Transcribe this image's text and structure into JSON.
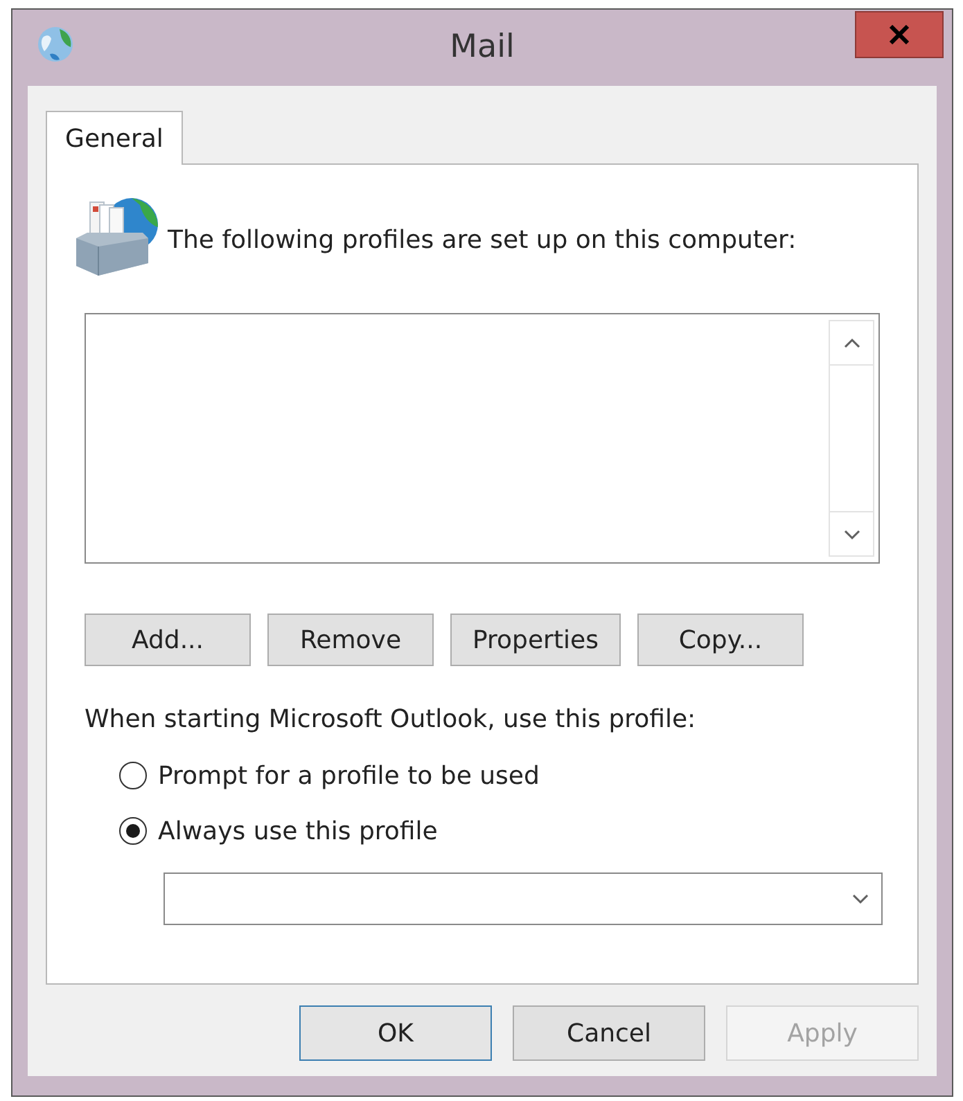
{
  "window": {
    "title": "Mail"
  },
  "tabs": [
    {
      "label": "General",
      "selected": true
    }
  ],
  "panel": {
    "heading": "The following profiles are set up on this computer:",
    "profile_actions": [
      "Add...",
      "Remove",
      "Properties",
      "Copy..."
    ],
    "startup_prompt": "When starting Microsoft Outlook, use this profile:",
    "startup_options": [
      {
        "label": "Prompt for a profile to be used",
        "selected": false
      },
      {
        "label": "Always use this profile",
        "selected": true
      }
    ]
  },
  "dialog_buttons": [
    {
      "label": "OK",
      "default": true,
      "disabled": false
    },
    {
      "label": "Cancel",
      "default": false,
      "disabled": false
    },
    {
      "label": "Apply",
      "default": false,
      "disabled": true
    }
  ]
}
